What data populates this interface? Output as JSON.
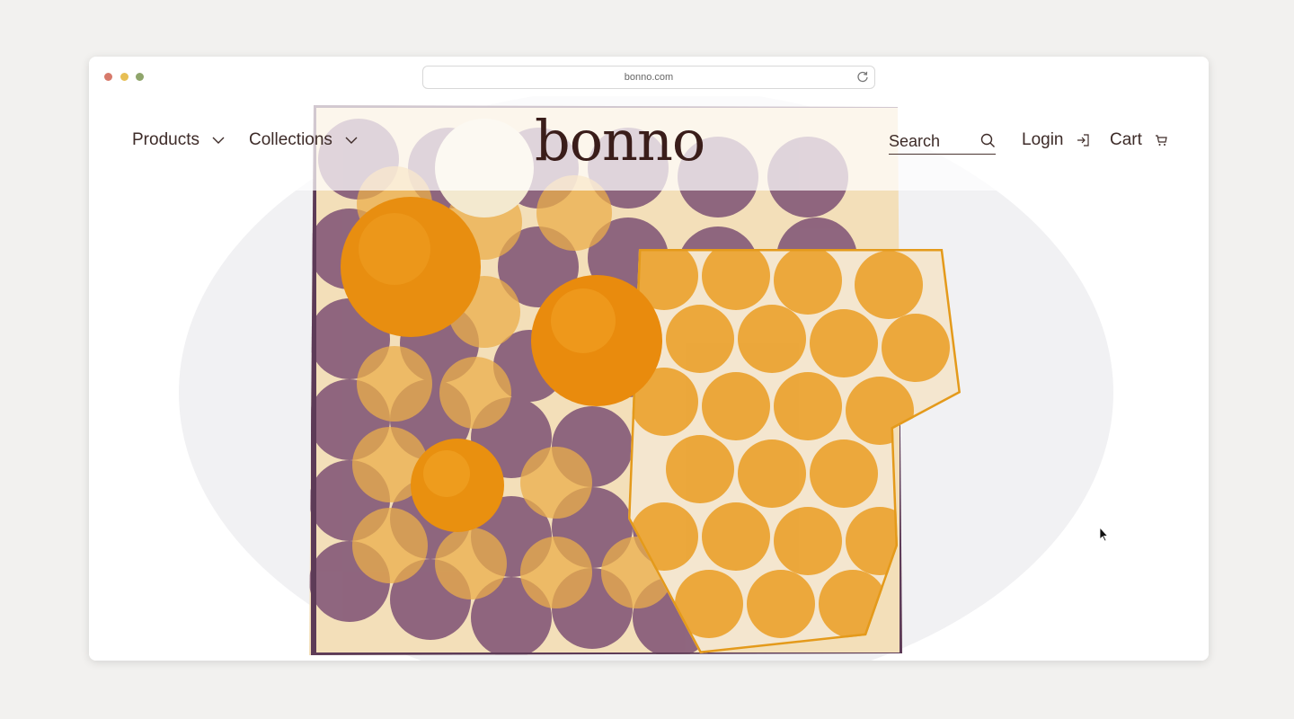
{
  "browser": {
    "url": "bonno.com"
  },
  "nav": {
    "products": "Products",
    "collections": "Collections",
    "logo": "bonno",
    "search_placeholder": "Search",
    "login": "Login",
    "cart": "Cart"
  },
  "colors": {
    "brand_dark": "#3a1d1a",
    "orange": "#e98f14",
    "plum": "#7b4f73",
    "linen": "#f2e8d7"
  },
  "icons": {
    "chevron": "chevron-down-icon",
    "search": "search-icon",
    "login": "login-arrow-icon",
    "cart": "cart-icon",
    "reload": "reload-icon"
  }
}
